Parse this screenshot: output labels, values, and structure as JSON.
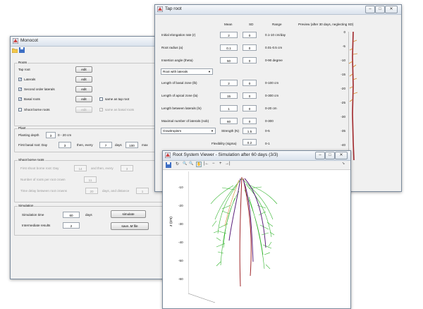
{
  "monocot": {
    "title": "Monocot",
    "roots_group": "Roots",
    "tap_root": "Tap root",
    "laterals": "Laterals",
    "second_order": "Second order laterals",
    "basal_roots": "Basal roots",
    "shoot_borne": "Shoot borne roots",
    "edit": "edit",
    "same_as_tap": "same as tap root",
    "same_as_basal": "same as basal roots",
    "plant_group": "Plant",
    "planting_depth_label": "Planting depth",
    "planting_depth": "3",
    "planting_depth_range": "0 - 20 cm",
    "first_basal_label": "First basal root: Day",
    "first_basal_day": "3",
    "then_every": "then, every",
    "every_days": "7",
    "days": "days",
    "max_val": "100",
    "max": "max",
    "shoot_group": "Shoot borne roots",
    "first_shoot_label": "First shoot borne root: Day",
    "first_shoot_day": "14",
    "and_then_every": "and then, every",
    "shoot_every": "3",
    "roots_per_crown_label": "Number of roots per root crown",
    "roots_per_crown": "11",
    "time_delay_label": "Time delay between root crowns",
    "time_delay": "20",
    "days_and_distance": "days, and distance",
    "distance": "1",
    "sim_group": "Simulation",
    "sim_time_label": "Simulation time",
    "sim_time": "60",
    "sim_days": "days",
    "intermediate_label": "Intermediate results",
    "intermediate": "2",
    "simulate": "simulate",
    "save_file": "save..M file"
  },
  "taproot": {
    "title": "Tap root",
    "col_mean": "Mean",
    "col_sd": "SD",
    "col_range": "Range",
    "preview_label": "Preview (after 30 days, neglecting SD)",
    "rows": [
      {
        "label": "Initial elongation rate (r)",
        "mean": "2",
        "sd": "0",
        "range": "0.1-10 cm/day"
      },
      {
        "label": "Root radius (a)",
        "mean": "0.1",
        "sd": "0",
        "range": "0.01-0.5 cm"
      },
      {
        "label": "Insertion angle (theta)",
        "mean": "50",
        "sd": "0",
        "range": "0-90 degree"
      }
    ],
    "root_type": "Root with laterals",
    "rows2": [
      {
        "label": "Length of basal zone (lb)",
        "mean": "2",
        "sd": "0",
        "range": "0-100 cm"
      },
      {
        "label": "Length of apical zone (la)",
        "mean": "15",
        "sd": "0",
        "range": "0-300 cm"
      },
      {
        "label": "Length between laterals (ln)",
        "mean": "1",
        "sd": "0",
        "range": "0-20 cm"
      },
      {
        "label": "Maximal number of laterals (nob)",
        "mean": "60",
        "sd": "0",
        "range": "0-300"
      }
    ],
    "tropism": "Gravitropism",
    "strength_label": "Strength (N)",
    "strength": "1.5",
    "strength_range": "0-5",
    "flex_label": "Flexibility (sigma)",
    "flex": "0.2",
    "flex_range": "0-1",
    "preview_ticks": [
      "0",
      "-5",
      "-10",
      "-15",
      "-20",
      "-25",
      "-30",
      "-35",
      "-40"
    ]
  },
  "viewer": {
    "title": "Root System Viewer - Simulation after 60 days (3/3)",
    "ylabel": "z (cm)",
    "ticks": [
      "-10",
      "-20",
      "-30",
      "-40",
      "-50",
      "-60"
    ],
    "toolbar_icons": [
      "save-icon",
      "rotate-icon",
      "zoom-in-icon",
      "zoom-out-icon",
      "pan-icon",
      "back-icon",
      "minus-icon",
      "plus-icon",
      "forward-icon"
    ],
    "toolbar_glyphs": [
      "↻",
      "🔍",
      "🔍",
      "✋",
      "|←",
      "−",
      "+",
      "→|"
    ]
  },
  "colors": {
    "green": "#2fb32a",
    "purple": "#5a1f7a",
    "red": "#a0262a",
    "orange": "#d4862a"
  }
}
